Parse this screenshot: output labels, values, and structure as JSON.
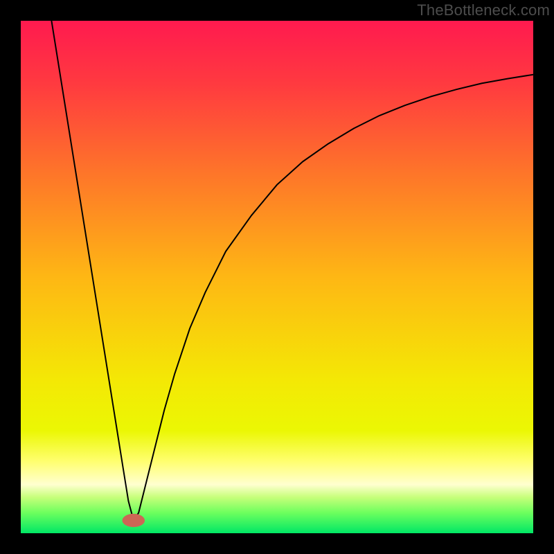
{
  "watermark": "TheBottleneck.com",
  "chart_data": {
    "type": "line",
    "title": "",
    "xlabel": "",
    "ylabel": "",
    "xlim": [
      0,
      100
    ],
    "ylim": [
      0,
      100
    ],
    "grid": false,
    "legend": false,
    "background": {
      "type": "vertical-gradient",
      "stops": [
        {
          "offset": 0.0,
          "color": "#ff1a4f"
        },
        {
          "offset": 0.12,
          "color": "#ff3940"
        },
        {
          "offset": 0.3,
          "color": "#fe7629"
        },
        {
          "offset": 0.5,
          "color": "#feb714"
        },
        {
          "offset": 0.7,
          "color": "#f4e805"
        },
        {
          "offset": 0.8,
          "color": "#ebf704"
        },
        {
          "offset": 0.86,
          "color": "#ffff70"
        },
        {
          "offset": 0.905,
          "color": "#ffffd0"
        },
        {
          "offset": 0.93,
          "color": "#c6ff7a"
        },
        {
          "offset": 0.96,
          "color": "#6dff5e"
        },
        {
          "offset": 1.0,
          "color": "#00e765"
        }
      ]
    },
    "marker": {
      "x": 22,
      "y": 2.5,
      "color": "#cc6655",
      "rx": 2.2,
      "ry": 1.3
    },
    "series": [
      {
        "name": "bottleneck-curve",
        "color": "#000000",
        "lineWidth": 2,
        "x": [
          6,
          8,
          10,
          12,
          14,
          16,
          18,
          20,
          21,
          22,
          23,
          24,
          26,
          28,
          30,
          33,
          36,
          40,
          45,
          50,
          55,
          60,
          65,
          70,
          75,
          80,
          85,
          90,
          95,
          100
        ],
        "y": [
          100,
          87.5,
          75,
          62.5,
          50,
          37.5,
          25,
          12.5,
          6.3,
          2.5,
          4,
          8,
          16,
          24,
          31,
          40,
          47,
          55,
          62,
          68,
          72.5,
          76,
          79,
          81.5,
          83.5,
          85.2,
          86.6,
          87.8,
          88.7,
          89.5
        ]
      }
    ]
  }
}
